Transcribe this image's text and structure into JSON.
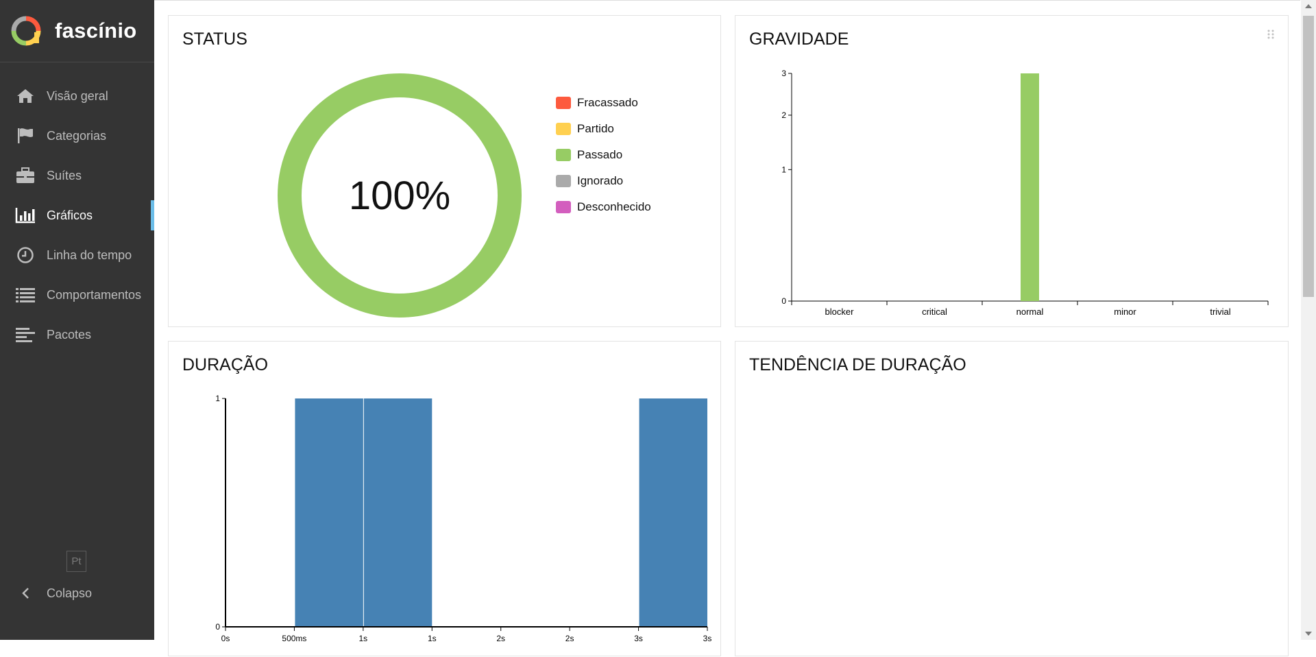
{
  "brand": {
    "name": "fascínio"
  },
  "sidebar": {
    "items": [
      {
        "label": "Visão geral",
        "icon": "home-icon",
        "active": false
      },
      {
        "label": "Categorias",
        "icon": "flag-icon",
        "active": false
      },
      {
        "label": "Suítes",
        "icon": "briefcase-icon",
        "active": false
      },
      {
        "label": "Gráficos",
        "icon": "bar-chart-icon",
        "active": true
      },
      {
        "label": "Linha do tempo",
        "icon": "clock-icon",
        "active": false
      },
      {
        "label": "Comportamentos",
        "icon": "list-icon",
        "active": false
      },
      {
        "label": "Pacotes",
        "icon": "align-left-icon",
        "active": false
      }
    ],
    "language": "Pt",
    "collapse_label": "Colapso"
  },
  "colors": {
    "sidebar_bg": "#343434",
    "active_indicator": "#6bbde8",
    "failed": "#fd5a3e",
    "broken": "#ffd050",
    "passed": "#97cc64",
    "skipped": "#aaaaaa",
    "unknown": "#d35ebe",
    "duration_bar": "#4682b4"
  },
  "cards": {
    "status": {
      "title": "STATUS"
    },
    "severity": {
      "title": "GRAVIDADE"
    },
    "duration": {
      "title": "DURAÇÃO"
    },
    "duration_trend": {
      "title": "TENDÊNCIA DE DURAÇÃO"
    }
  },
  "chart_data": [
    {
      "type": "pie",
      "title": "STATUS",
      "center_label": "100%",
      "categories": [
        "Fracassado",
        "Partido",
        "Passado",
        "Ignorado",
        "Desconhecido"
      ],
      "values": [
        0,
        0,
        3,
        0,
        0
      ],
      "colors": [
        "#fd5a3e",
        "#ffd050",
        "#97cc64",
        "#aaaaaa",
        "#d35ebe"
      ],
      "legend": "right"
    },
    {
      "type": "bar",
      "title": "GRAVIDADE",
      "categories": [
        "blocker",
        "critical",
        "normal",
        "minor",
        "trivial"
      ],
      "values": [
        0,
        0,
        3,
        0,
        0
      ],
      "color": "#97cc64",
      "ylim": [
        0,
        3
      ],
      "yticks": [
        0,
        1,
        2,
        3
      ],
      "yscale": "sqrt"
    },
    {
      "type": "bar",
      "title": "DURAÇÃO",
      "bins": [
        {
          "start": "500ms",
          "end": "1s",
          "count": 1
        },
        {
          "start": "1s",
          "end": "1s",
          "count": 1
        },
        {
          "start": "3s",
          "end": "3s",
          "count": 1
        }
      ],
      "xticks": [
        "0s",
        "500ms",
        "1s",
        "1s",
        "2s",
        "2s",
        "3s",
        "3s"
      ],
      "bin_tick_index": [
        [
          1,
          2
        ],
        [
          2,
          3
        ],
        [
          6,
          7
        ]
      ],
      "ylim": [
        0,
        1
      ],
      "yticks": [
        0,
        1
      ],
      "color": "#4682b4"
    }
  ]
}
